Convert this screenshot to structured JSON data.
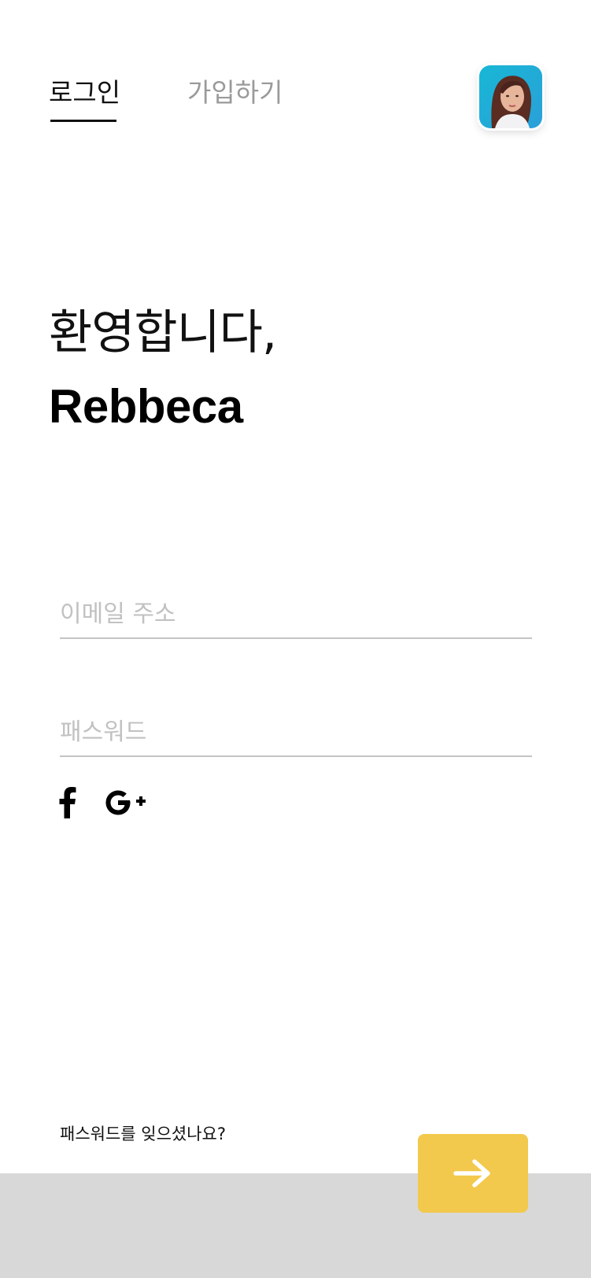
{
  "tabs": {
    "login": "로그인",
    "signup": "가입하기"
  },
  "welcome": {
    "greeting": "환영합니다,",
    "name": "Rebbeca"
  },
  "form": {
    "email_placeholder": "이메일 주소",
    "email_value": "",
    "password_placeholder": "패스워드",
    "password_value": ""
  },
  "social": [
    "facebook-icon",
    "google-plus-icon"
  ],
  "forgot_password": "패스워드를 잊으셨나요?",
  "submit": {
    "icon": "arrow-right-icon"
  },
  "colors": {
    "accent": "#f2c94c",
    "bottom_bar": "#d8d8d8",
    "active_tab": "#111111",
    "inactive_tab": "#9a9a9a",
    "placeholder": "#c1c1c1",
    "field_line": "#c4c4c4"
  }
}
